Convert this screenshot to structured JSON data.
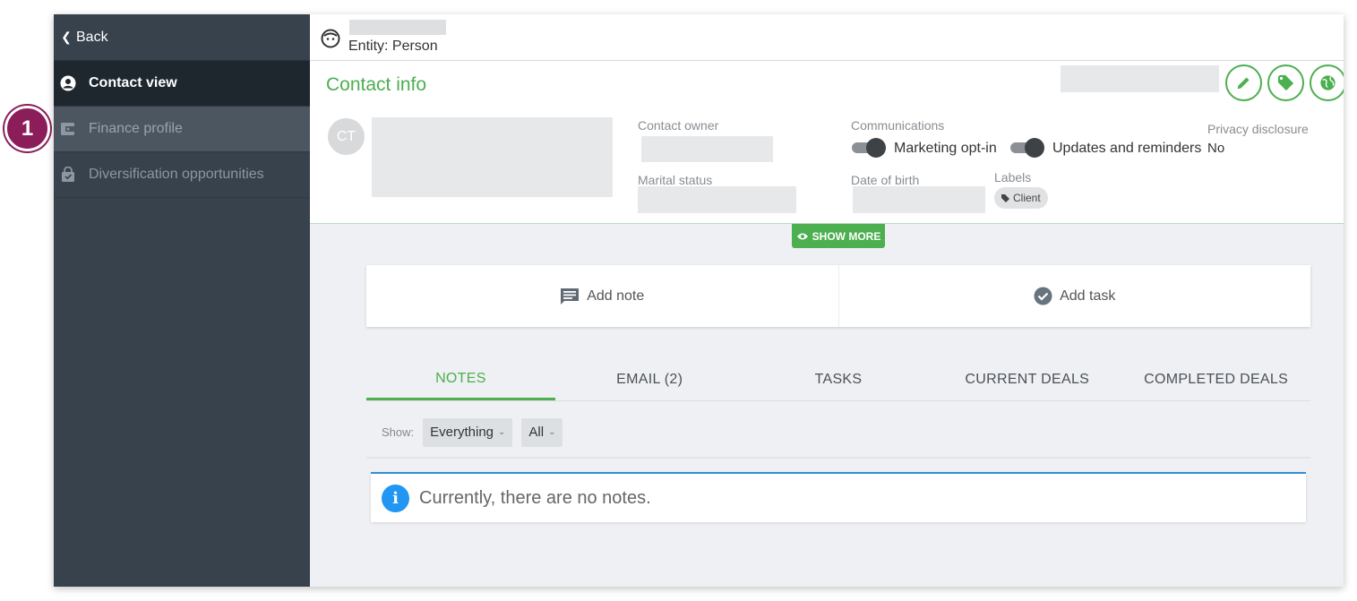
{
  "sidebar": {
    "back_label": "Back",
    "items": [
      {
        "label": "Contact view",
        "icon": "user-circle-icon",
        "state": "active"
      },
      {
        "label": "Finance profile",
        "icon": "wallet-icon",
        "state": "hover"
      },
      {
        "label": "Diversification opportunities",
        "icon": "bag-icon",
        "state": "normal"
      }
    ]
  },
  "header": {
    "entity_label": "Entity: Person"
  },
  "contact_info": {
    "title": "Contact info",
    "avatar_initials": "CT",
    "contact_owner_label": "Contact owner",
    "marital_status_label": "Marital status",
    "communications_label": "Communications",
    "marketing_optin_label": "Marketing opt-in",
    "updates_label": "Updates and reminders",
    "privacy_label": "Privacy disclosure",
    "privacy_value": "No",
    "dob_label": "Date of birth",
    "labels_label": "Labels",
    "label_chip": "Client",
    "show_more": "SHOW MORE"
  },
  "actions": {
    "add_note": "Add note",
    "add_task": "Add task"
  },
  "tabs": [
    {
      "label": "NOTES",
      "active": true
    },
    {
      "label": "EMAIL (2)",
      "active": false
    },
    {
      "label": "TASKS",
      "active": false
    },
    {
      "label": "CURRENT DEALS",
      "active": false
    },
    {
      "label": "COMPLETED DEALS",
      "active": false
    }
  ],
  "filters": {
    "show_label": "Show:",
    "type_value": "Everything",
    "scope_value": "All"
  },
  "notice": {
    "text": "Currently, there are no notes."
  },
  "annotation": {
    "step_number": "1"
  },
  "colors": {
    "sidebar_bg": "#37424d",
    "accent_green": "#4caf50",
    "info_blue": "#2196f3",
    "badge_magenta": "#8b1e5a"
  }
}
